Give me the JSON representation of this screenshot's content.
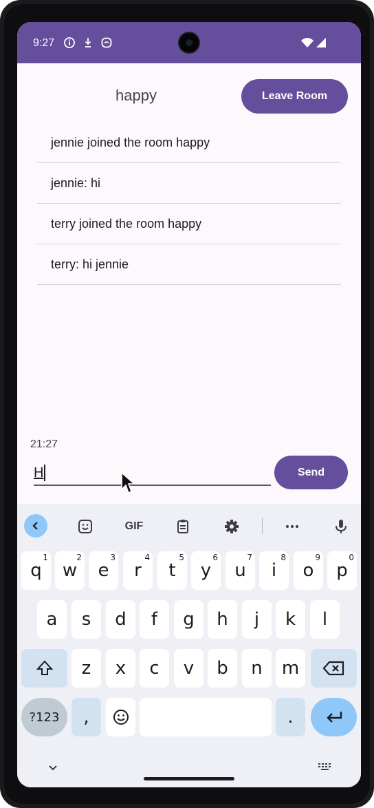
{
  "status_bar": {
    "time": "9:27",
    "icons": [
      "info-icon",
      "download-icon",
      "app-icon",
      "wifi-icon",
      "signal-icon"
    ]
  },
  "header": {
    "room_name": "happy",
    "leave_label": "Leave Room"
  },
  "messages": [
    "jennie joined the room happy",
    "jennie: hi",
    "terry joined the room happy",
    "terry: hi jennie"
  ],
  "composer": {
    "timestamp": "21:27",
    "input_value": "H",
    "send_label": "Send"
  },
  "keyboard": {
    "toolbar": [
      "chevron-left-icon",
      "sticker-icon",
      "GIF",
      "clipboard-icon",
      "gear-icon",
      "more-icon",
      "mic-icon"
    ],
    "row1": [
      "q",
      "w",
      "e",
      "r",
      "t",
      "y",
      "u",
      "i",
      "o",
      "p"
    ],
    "row1_numbers": [
      "1",
      "2",
      "3",
      "4",
      "5",
      "6",
      "7",
      "8",
      "9",
      "0"
    ],
    "row2": [
      "a",
      "s",
      "d",
      "f",
      "g",
      "h",
      "j",
      "k",
      "l"
    ],
    "row3": [
      "z",
      "x",
      "c",
      "v",
      "b",
      "n",
      "m"
    ],
    "symbols_label": "?123",
    "comma": ",",
    "period": "."
  },
  "colors": {
    "primary": "#654f9c",
    "background": "#fdf8fc",
    "keyboard_bg": "#eef0f6",
    "accent_key": "#8fc8f8"
  }
}
